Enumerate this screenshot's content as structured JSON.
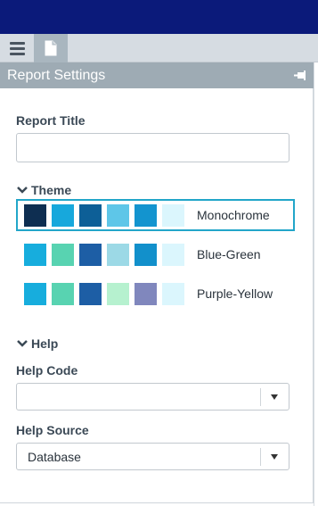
{
  "panel": {
    "title": "Report Settings"
  },
  "report_title": {
    "label": "Report Title",
    "value": "",
    "placeholder": ""
  },
  "theme": {
    "label": "Theme",
    "options": [
      {
        "name": "Monochrome",
        "selected": true,
        "colors": [
          "#0e2e51",
          "#17a8dc",
          "#0d5f97",
          "#5ec6e8",
          "#1394cf",
          "#dbf6fd"
        ]
      },
      {
        "name": "Blue-Green",
        "selected": false,
        "colors": [
          "#17addd",
          "#58d3b1",
          "#1d5ea5",
          "#9cd9e6",
          "#1290cb",
          "#dbf6fd"
        ]
      },
      {
        "name": "Purple-Yellow",
        "selected": false,
        "colors": [
          "#17addd",
          "#58d3b1",
          "#1d5ea5",
          "#b6f1cf",
          "#8087bd",
          "#dbf6fd"
        ]
      }
    ]
  },
  "help": {
    "label": "Help",
    "code": {
      "label": "Help Code",
      "value": ""
    },
    "source": {
      "label": "Help Source",
      "value": "Database"
    }
  },
  "colors": {
    "top_bar": "#0b1a7a",
    "header": "#9eabb4",
    "selected_border": "#22a6c9"
  }
}
